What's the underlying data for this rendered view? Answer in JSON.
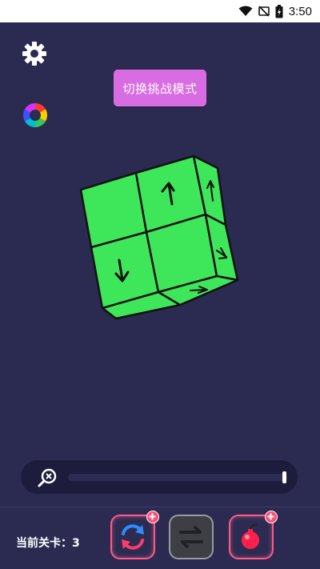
{
  "status_bar": {
    "time": "3:50"
  },
  "challenge_button": {
    "label": "切换挑战模式"
  },
  "level": {
    "label": "当前关卡：3"
  },
  "zoom": {
    "level": 1.0
  },
  "colors": {
    "background": "#2b2b52",
    "cube_green": "#3ee65a",
    "challenge_button": "#d96ce3",
    "tool_border": "#ff5a8c"
  },
  "toolbar": {
    "items": [
      {
        "icon": "refresh-icon",
        "badge": "plus"
      },
      {
        "icon": "swap-icon"
      },
      {
        "icon": "bomb-icon",
        "badge": "plus"
      }
    ]
  }
}
